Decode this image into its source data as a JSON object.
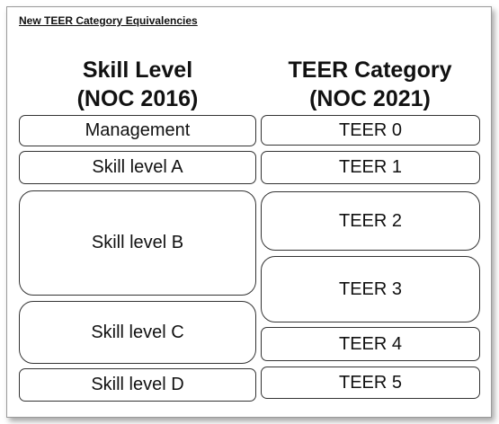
{
  "title": "New TEER Category Equivalencies",
  "headers": {
    "left": {
      "line1": "Skill Level",
      "line2": "(NOC 2016)"
    },
    "right": {
      "line1": "TEER Category",
      "line2": "(NOC 2021)"
    }
  },
  "skill_levels": [
    "Management",
    "Skill level A",
    "Skill level B",
    "Skill level C",
    "Skill level D"
  ],
  "teer_categories": [
    "TEER 0",
    "TEER 1",
    "TEER 2",
    "TEER 3",
    "TEER 4",
    "TEER 5"
  ]
}
